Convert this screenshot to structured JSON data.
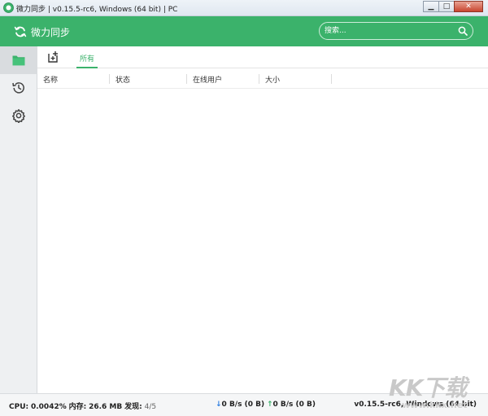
{
  "window": {
    "title": "微力同步 | v0.15.5-rc6, Windows (64 bit) | PC",
    "minimize_label": "▁",
    "maximize_label": "□",
    "close_label": "✕"
  },
  "header": {
    "app_name": "微力同步",
    "logo_icon": "sync-icon",
    "search": {
      "placeholder": "搜索..."
    },
    "accent_color": "#3bb26b"
  },
  "sidebar": {
    "items": [
      {
        "name": "folders",
        "icon": "folder-icon",
        "active": true
      },
      {
        "name": "history",
        "icon": "history-icon",
        "active": false
      },
      {
        "name": "settings",
        "icon": "gear-icon",
        "active": false
      }
    ]
  },
  "toolbar": {
    "add_icon": "add-folder-icon",
    "tabs": [
      {
        "label": "所有",
        "active": true
      }
    ]
  },
  "table": {
    "columns": [
      "名称",
      "状态",
      "在线用户",
      "大小"
    ],
    "rows": []
  },
  "status": {
    "cpu_label": "CPU:",
    "cpu_value": "0.0042%",
    "mem_label": "内存:",
    "mem_value": "26.6 MB",
    "discovery_label": "发现:",
    "discovery_value": "4/5",
    "down_arrow": "↓",
    "down_speed": "0 B/s (0 B)",
    "up_arrow": "↑",
    "up_speed": "0 B/s (0 B)",
    "version": "v0.15.5-rc6, Windows (64 bit)"
  },
  "watermark": {
    "brand": "KK下载",
    "url": "www.kkx.net"
  }
}
